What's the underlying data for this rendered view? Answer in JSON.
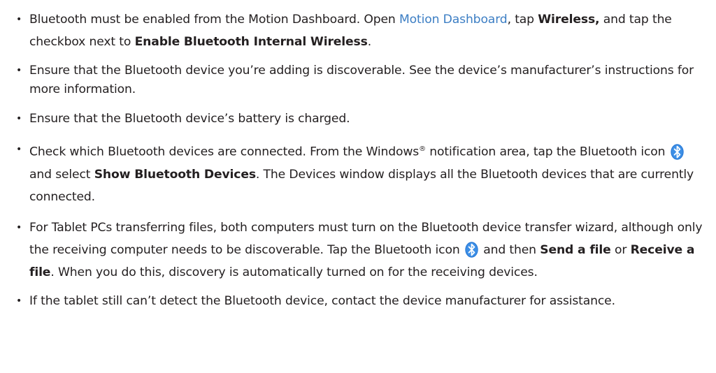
{
  "bullets": [
    {
      "before_link": "Bluetooth must be enabled from the Motion Dashboard. Open ",
      "link": "Motion Dashboard",
      "after_link": ", tap ",
      "bold1": "Wireless,",
      "middle": " and tap the checkbox next to ",
      "bold2": "Enable Bluetooth Internal Wireless",
      "end": "."
    },
    {
      "text": "Ensure that the Bluetooth device you’re adding is discoverable. See the device’s manufacturer’s instructions for more information."
    },
    {
      "text": "Ensure that the Bluetooth device’s battery is charged."
    },
    {
      "before_sup": "Check which Bluetooth devices are connected. From the Windows",
      "sup": "®",
      "after_sup": " notification area, tap the Bluetooth icon ",
      "after_icon": " and select ",
      "bold": "Show Bluetooth Devices",
      "end": ". The Devices window displays all the Bluetooth devices that are currently connected."
    },
    {
      "before_icon": "For Tablet PCs transferring files, both computers must turn on the Bluetooth device transfer wizard, although only the receiving computer needs to be discoverable. Tap the Bluetooth icon ",
      "after_icon": " and then ",
      "bold1": "Send a file",
      "middle": " or ",
      "bold2": "Receive a file",
      "end": ". When you do this, discovery is automatically turned on for the receiving devices."
    },
    {
      "text": "If the tablet still can’t detect the Bluetooth device, contact the device manufacturer for assistance."
    }
  ],
  "colors": {
    "text": "#231f20",
    "link": "#3c7ec4",
    "icon": "#2a7ad6"
  },
  "icons": {
    "bluetooth": "bluetooth-icon"
  }
}
